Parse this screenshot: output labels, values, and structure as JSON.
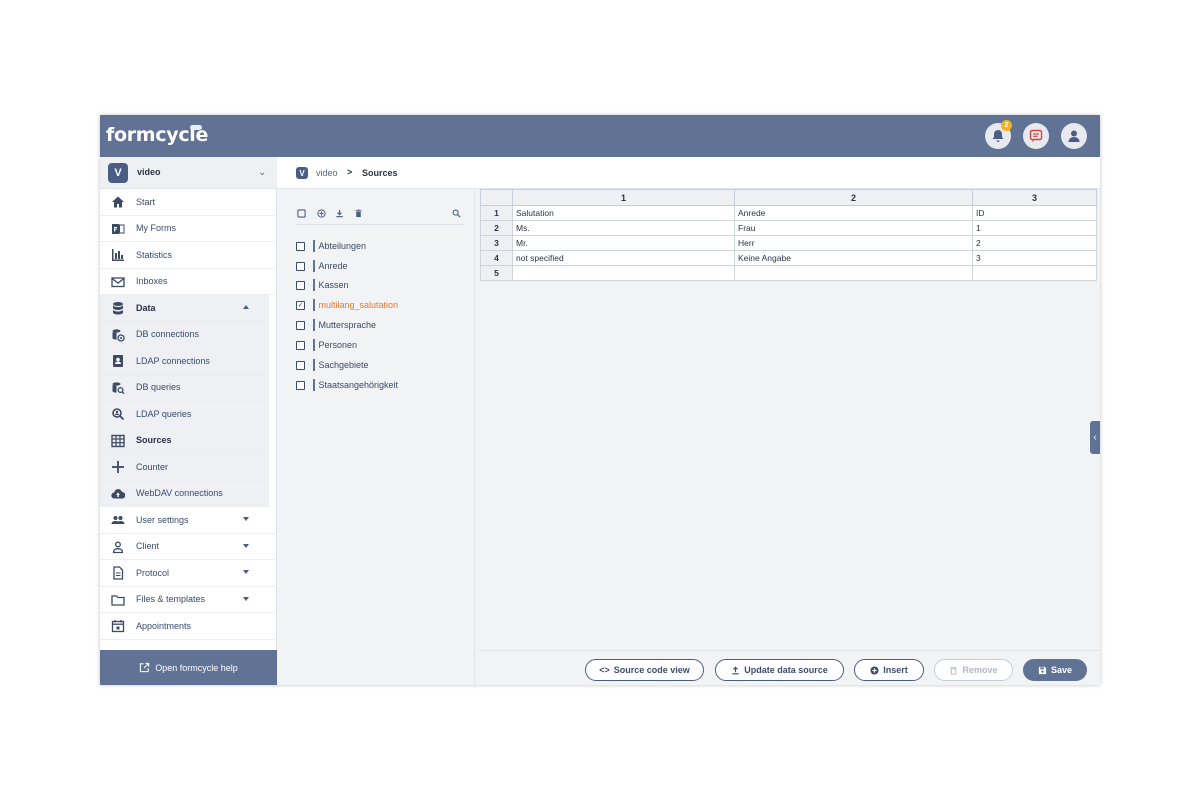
{
  "app": {
    "logo_text": "formcycle"
  },
  "topbar": {
    "notification_count": "2",
    "icons": [
      "bell-icon",
      "chat-icon",
      "user-avatar-icon"
    ]
  },
  "project": {
    "badge": "V",
    "name": "video"
  },
  "nav": {
    "start": "Start",
    "my_forms": "My Forms",
    "statistics": "Statistics",
    "inboxes": "Inboxes",
    "data": "Data",
    "db_connections": "DB connections",
    "ldap_connections": "LDAP connections",
    "db_queries": "DB queries",
    "ldap_queries": "LDAP queries",
    "sources": "Sources",
    "counter": "Counter",
    "webdav": "WebDAV connections",
    "user_settings": "User settings",
    "client": "Client",
    "protocol": "Protocol",
    "files_templates": "Files & templates",
    "appointments": "Appointments"
  },
  "help": {
    "label": "Open formcycle help"
  },
  "breadcrumb": {
    "badge": "V",
    "project": "video",
    "separator": ">",
    "current": "Sources"
  },
  "sources": [
    {
      "name": "Abteilungen",
      "checked": false
    },
    {
      "name": "Anrede",
      "checked": false
    },
    {
      "name": "Kassen",
      "checked": false
    },
    {
      "name": "multilang_salutation",
      "checked": true
    },
    {
      "name": "Muttersprache",
      "checked": false
    },
    {
      "name": "Personen",
      "checked": false
    },
    {
      "name": "Sachgebiete",
      "checked": false
    },
    {
      "name": "Staatsangehörigkeit",
      "checked": false
    }
  ],
  "table": {
    "columns": [
      "1",
      "2",
      "3"
    ],
    "rows": [
      {
        "num": "1",
        "cells": [
          "Salutation",
          "Anrede",
          "ID"
        ]
      },
      {
        "num": "2",
        "cells": [
          "Ms.",
          "Frau",
          "1"
        ]
      },
      {
        "num": "3",
        "cells": [
          "Mr.",
          "Herr",
          "2"
        ]
      },
      {
        "num": "4",
        "cells": [
          "not specified",
          "Keine Angabe",
          "3"
        ]
      },
      {
        "num": "5",
        "cells": [
          "",
          "",
          ""
        ]
      }
    ]
  },
  "footer": {
    "source_code_view": "Source code view",
    "update_data_source": "Update data source",
    "insert": "Insert",
    "remove": "Remove",
    "save": "Save"
  },
  "colors": {
    "header": "#607394",
    "active_source": "#e8772e",
    "badge": "#f0b323"
  }
}
